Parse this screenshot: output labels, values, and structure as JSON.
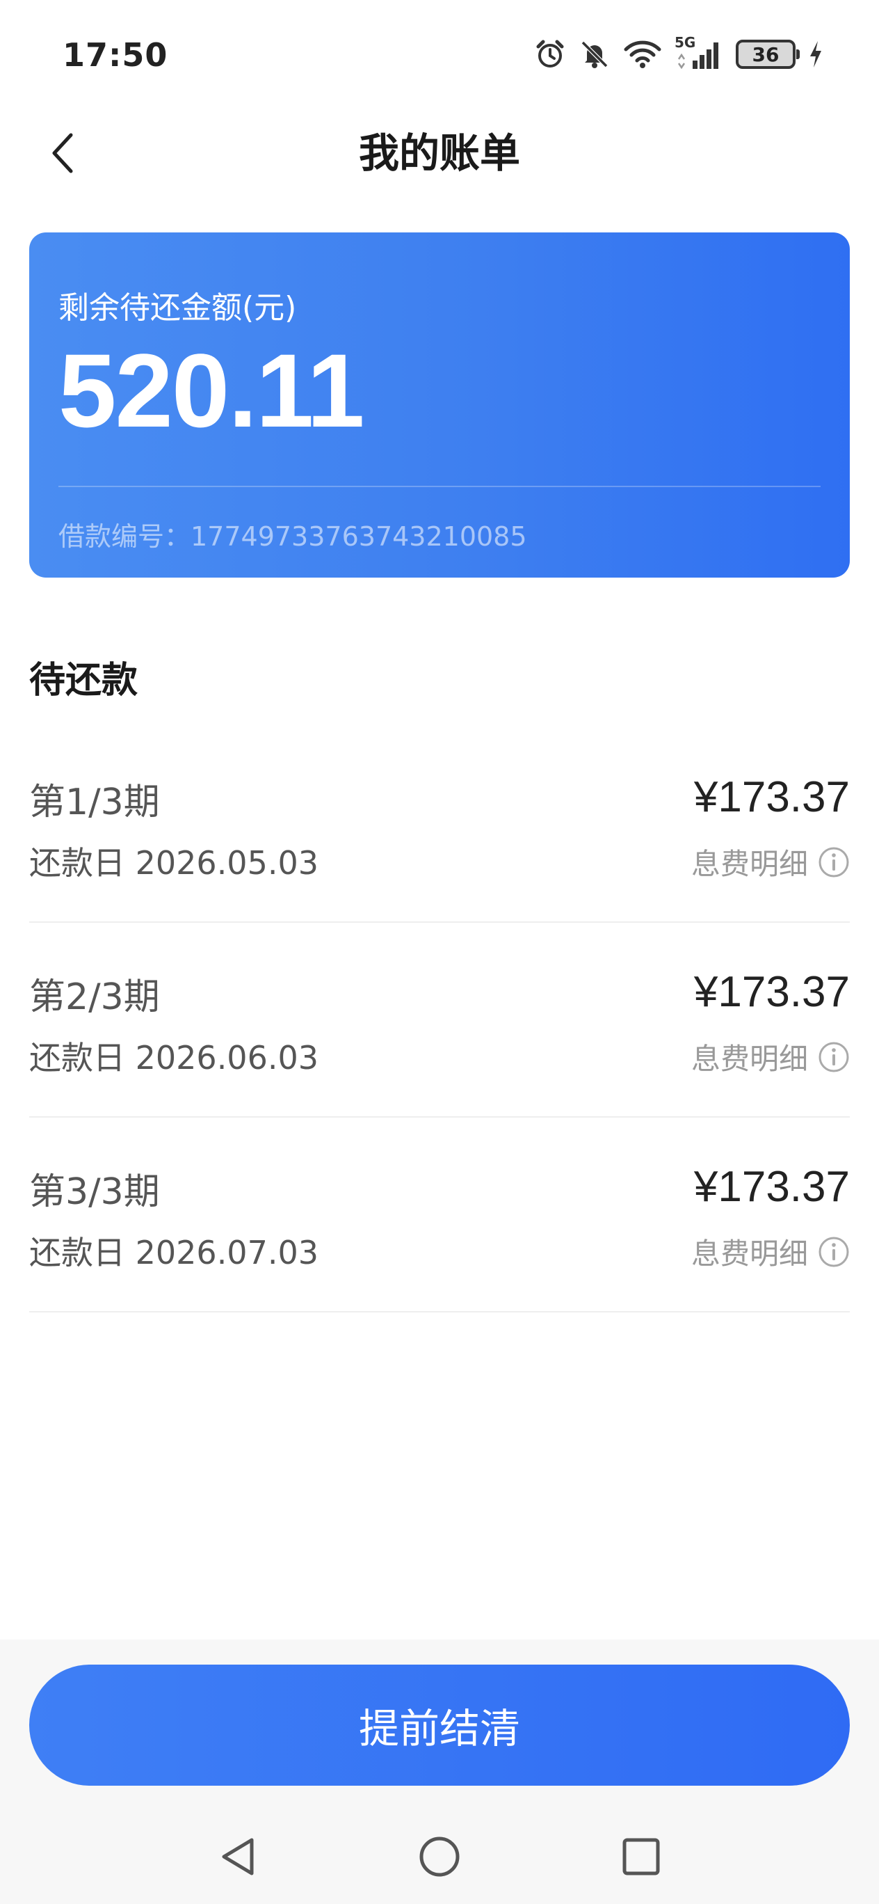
{
  "status_bar": {
    "time": "17:50",
    "network": "5G",
    "battery": "36",
    "icons": [
      "alarm-icon",
      "mute-bell-icon",
      "wifi-icon",
      "signal-icon",
      "battery-icon",
      "charging-icon"
    ]
  },
  "header": {
    "title": "我的账单",
    "back_icon": "chevron-left-icon"
  },
  "summary": {
    "label": "剩余待还金额(元)",
    "amount": "520.11",
    "loan_id": "借款编号：17749733763743210085"
  },
  "section": {
    "title": "待还款"
  },
  "installments": [
    {
      "period": "第1/3期",
      "due_date": "还款日 2026.05.03",
      "amount": "¥173.37",
      "detail_label": "息费明细"
    },
    {
      "period": "第2/3期",
      "due_date": "还款日 2026.06.03",
      "amount": "¥173.37",
      "detail_label": "息费明细"
    },
    {
      "period": "第3/3期",
      "due_date": "还款日 2026.07.03",
      "amount": "¥173.37",
      "detail_label": "息费明细"
    }
  ],
  "action": {
    "prepay_label": "提前结清"
  },
  "nav": {
    "icons": [
      "nav-back-icon",
      "nav-home-icon",
      "nav-recents-icon"
    ]
  },
  "colors": {
    "accent": "#3e7ff0",
    "card_gradient_start": "#4a8df2",
    "card_gradient_end": "#2f6ff2",
    "muted_text": "#999999"
  }
}
